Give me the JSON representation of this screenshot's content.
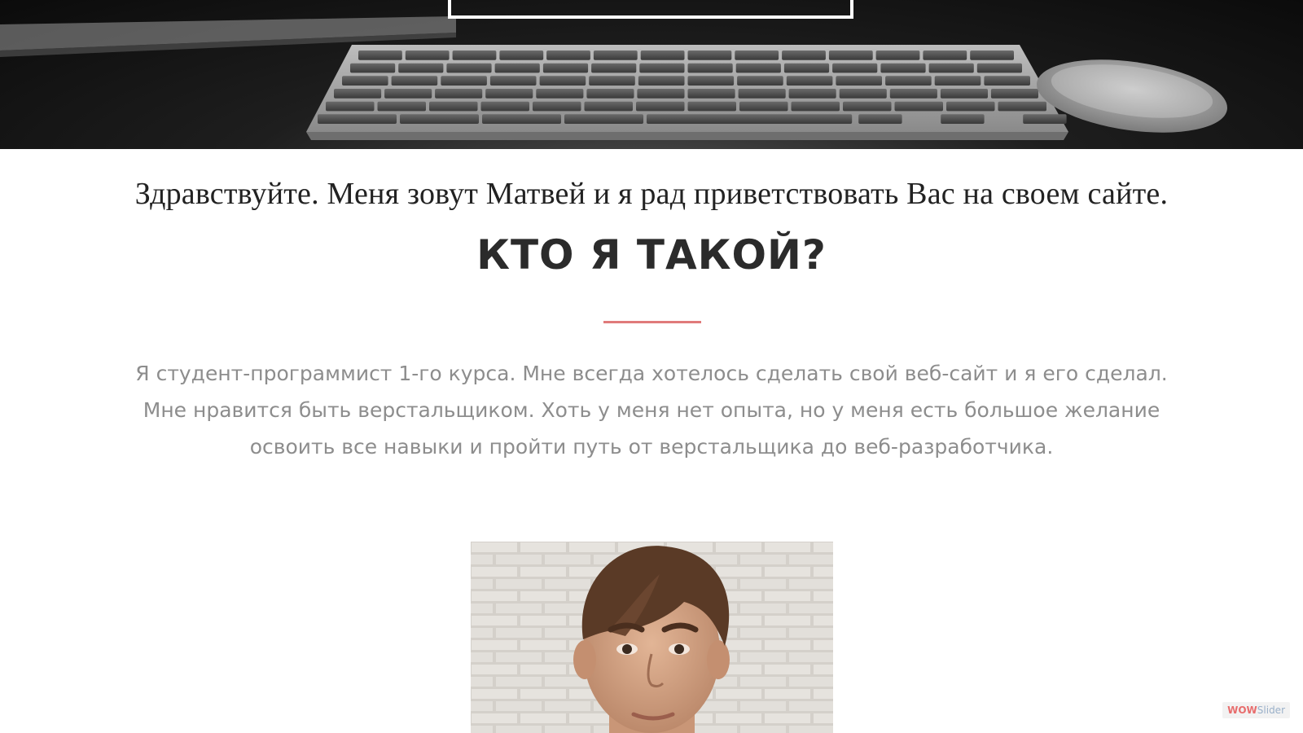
{
  "hero": {
    "image": "keyboard-desk-photo"
  },
  "content": {
    "greeting": "Здравствуйте. Меня зовут Матвей и я рад приветствовать Вас на своем сайте.",
    "title": "КТО Я ТАКОЙ?",
    "divider_color": "#e07a7a",
    "about_lines": [
      "Я студент-программист 1-го курса. Мне всегда хотелось сделать свой веб-сайт и я его сделал.",
      "Мне нравится быть верстальщиком. Хоть у меня нет опыта, но у меня есть большое желание",
      "освоить все навыки и пройти путь от верстальщика до веб-разработчика."
    ]
  },
  "portrait": {
    "image": "portrait-photo"
  },
  "badge": {
    "part1": "WOW",
    "part2": "Slider"
  }
}
